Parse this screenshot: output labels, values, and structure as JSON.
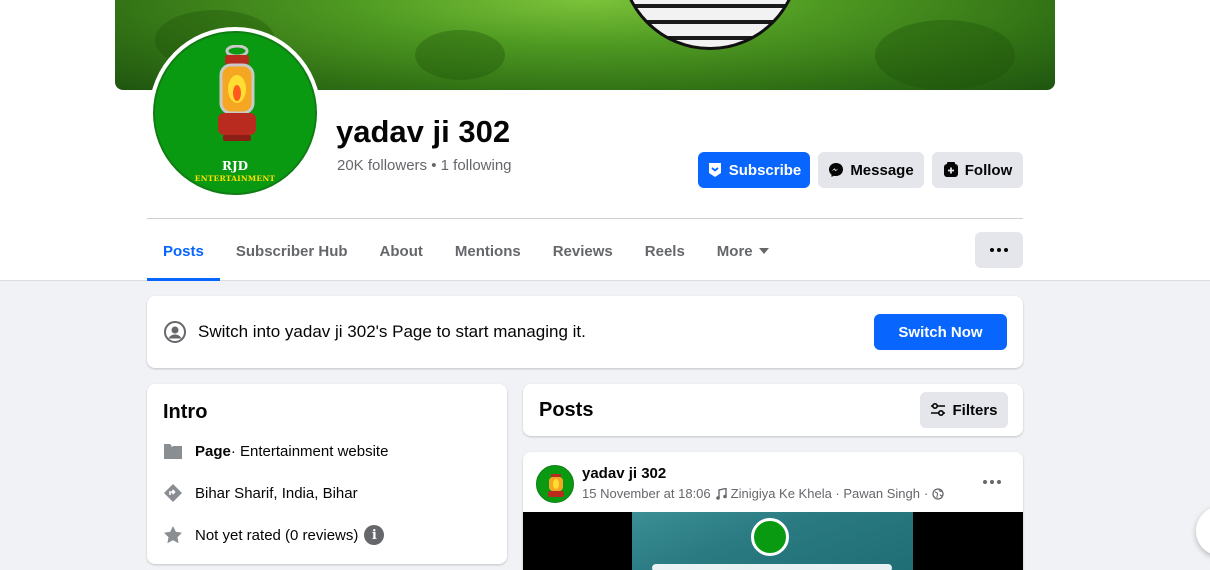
{
  "profile": {
    "name": "yadav ji 302",
    "followers": "20K followers",
    "separator": " • ",
    "following": "1 following",
    "avatar_text_main": "RJD",
    "avatar_text_sub": "ENTERTAINMENT"
  },
  "actions": {
    "subscribe_label": "Subscribe",
    "message_label": "Message",
    "follow_label": "Follow"
  },
  "tabs": [
    {
      "label": "Posts",
      "active": true
    },
    {
      "label": "Subscriber Hub"
    },
    {
      "label": "About"
    },
    {
      "label": "Mentions"
    },
    {
      "label": "Reviews"
    },
    {
      "label": "Reels"
    },
    {
      "label": "More"
    }
  ],
  "switch_banner": {
    "text": "Switch into yadav ji 302's Page to start managing it.",
    "button_label": "Switch Now"
  },
  "intro": {
    "title": "Intro",
    "page_label": "Page",
    "page_category": " · Entertainment website",
    "location": "Bihar Sharif, India, Bihar",
    "rating": "Not yet rated (0 reviews)",
    "info_glyph": "i"
  },
  "posts_header": {
    "title": "Posts",
    "filters_label": "Filters"
  },
  "post": {
    "author": "yadav ji 302",
    "date": "15 November at 18:06",
    "dot": " · ",
    "song": "Zinigiya Ke Khela · Pawan Singh",
    "dot2": " · "
  },
  "colors": {
    "accent": "#0866ff",
    "avatar_green": "#0a9a12",
    "page_bg": "#f0f2f5"
  },
  "icons": [
    "subscribe-icon",
    "messenger-icon",
    "follow-icon",
    "profile-switch-icon",
    "page-icon",
    "location-icon",
    "star-icon",
    "info-icon",
    "filters-icon",
    "music-icon",
    "globe-icon"
  ]
}
